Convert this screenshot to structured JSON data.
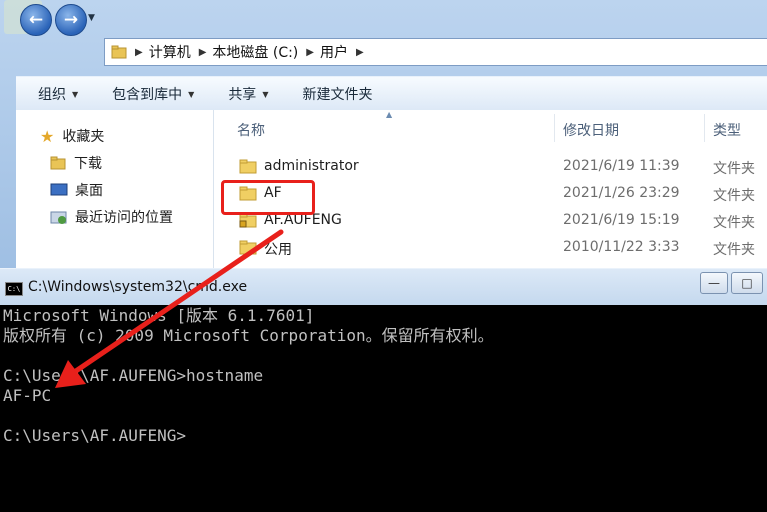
{
  "breadcrumb": [
    "计算机",
    "本地磁盘 (C:)",
    "用户"
  ],
  "toolbar": {
    "organize": "组织",
    "include_library": "包含到库中",
    "share": "共享",
    "new_folder": "新建文件夹"
  },
  "sidebar": {
    "favorites": "收藏夹",
    "items": [
      "下载",
      "桌面",
      "最近访问的位置"
    ]
  },
  "columns": {
    "name": "名称",
    "date": "修改日期",
    "type": "类型"
  },
  "files": [
    {
      "name": "administrator",
      "date": "2021/6/19 11:39",
      "type": "文件夹"
    },
    {
      "name": "AF",
      "date": "2021/1/26 23:29",
      "type": "文件夹"
    },
    {
      "name": "AF.AUFENG",
      "date": "2021/6/19 15:19",
      "type": "文件夹"
    },
    {
      "name": "公用",
      "date": "2010/11/22 3:33",
      "type": "文件夹"
    }
  ],
  "cmd": {
    "title": "C:\\Windows\\system32\\cmd.exe",
    "lines": [
      "Microsoft Windows [版本 6.1.7601]",
      "版权所有 (c) 2009 Microsoft Corporation。保留所有权利。",
      "",
      "C:\\Users\\AF.AUFENG>hostname",
      "AF-PC",
      "",
      "C:\\Users\\AF.AUFENG>"
    ]
  },
  "annotation_color": "#e8201b"
}
